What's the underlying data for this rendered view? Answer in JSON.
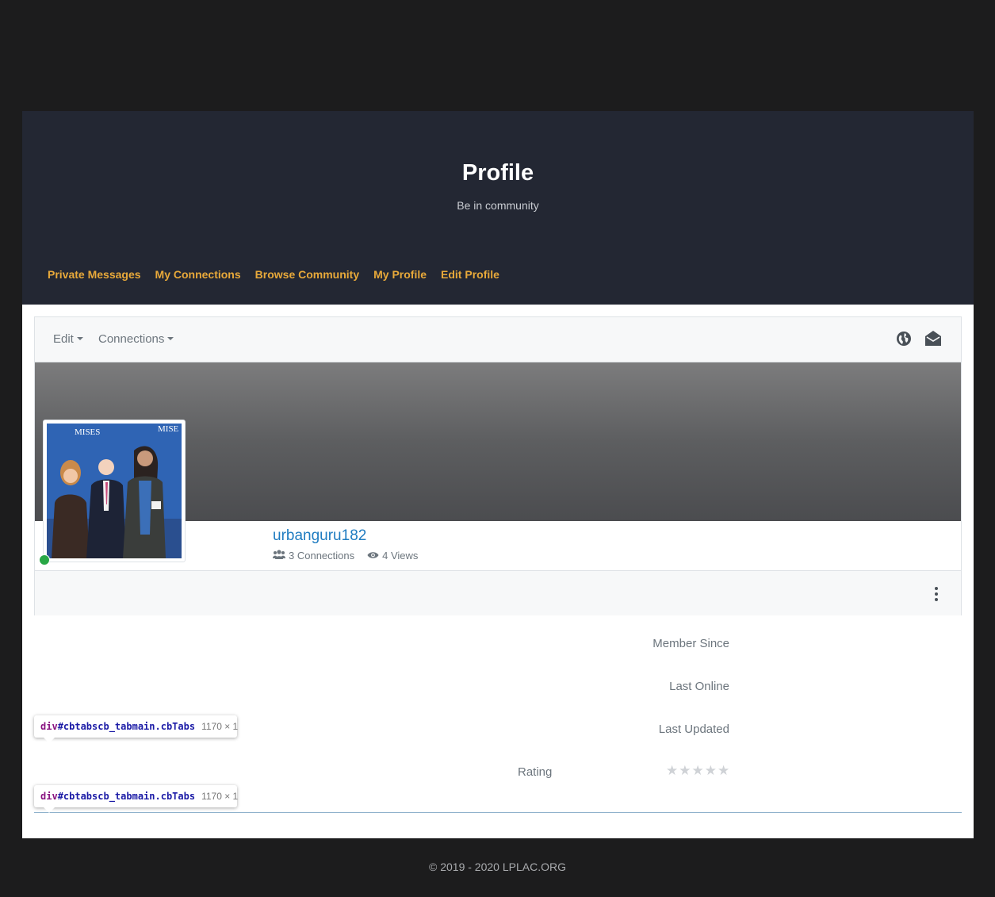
{
  "hero": {
    "title": "Profile",
    "subtitle": "Be in community",
    "nav": [
      "Private Messages",
      "My Connections",
      "Browse Community",
      "My Profile",
      "Edit Profile"
    ]
  },
  "profile_header": {
    "edit_label": "Edit",
    "connections_label": "Connections",
    "icons": [
      "globe-icon",
      "envelope-open-icon"
    ]
  },
  "profile": {
    "username": "urbanguru182",
    "connections_text": "3 Connections",
    "views_text": "4 Views",
    "status": "online"
  },
  "info": {
    "member_since_label": "Member Since",
    "last_online_label": "Last Online",
    "last_updated_label": "Last Updated",
    "rating_label": "Rating",
    "rating_value": 0,
    "rating_max": 5
  },
  "devtools_tooltip": {
    "tag": "div",
    "selector": "#cbtabscb_tabmain.cbTabs",
    "size": "1170 × 1"
  },
  "footer": {
    "copyright": "© 2019 - 2020 LPLAC.ORG"
  },
  "colors": {
    "accent": "#e8a93a",
    "link": "#1f7cc1",
    "online": "#28a745"
  }
}
